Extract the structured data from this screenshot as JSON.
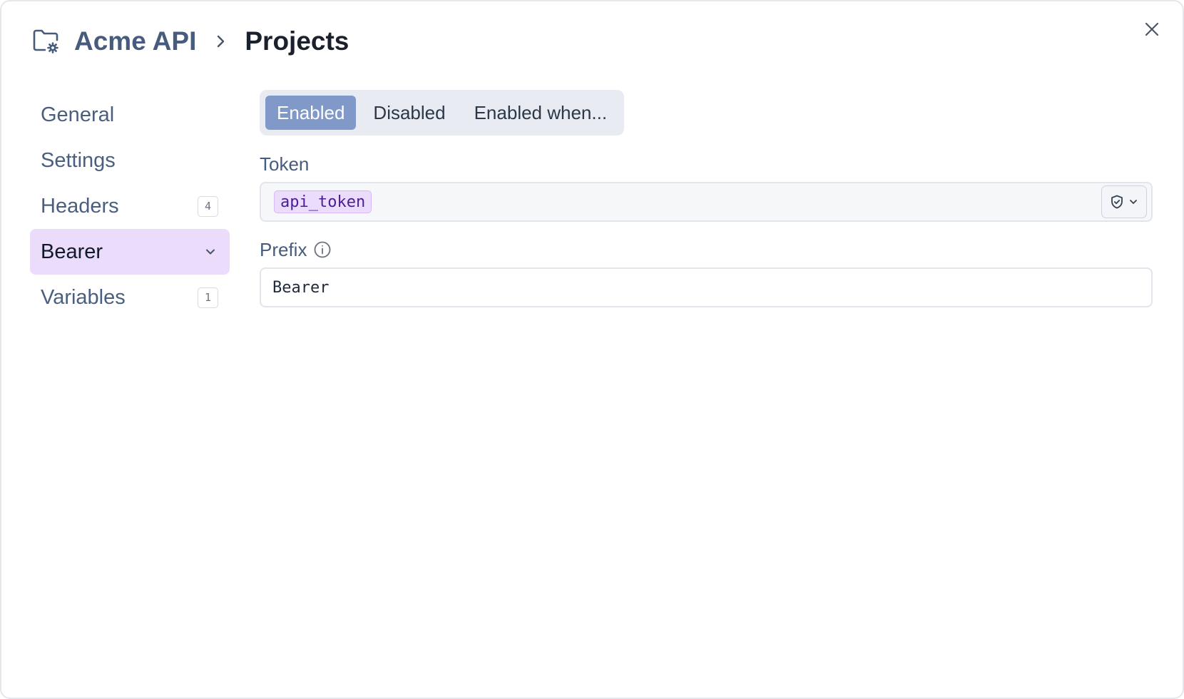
{
  "breadcrumb": {
    "parent": "Acme API",
    "current": "Projects"
  },
  "icons": {
    "folder": "folder-gear-icon",
    "separator": "chevron-right-icon",
    "close": "close-icon",
    "info": "info-icon",
    "shield": "shield-check-icon",
    "chevron_down": "chevron-down-icon"
  },
  "sidebar": {
    "items": [
      {
        "label": "General",
        "badge": ""
      },
      {
        "label": "Settings",
        "badge": ""
      },
      {
        "label": "Headers",
        "badge": "4"
      },
      {
        "label": "Bearer",
        "badge": "",
        "active": true
      },
      {
        "label": "Variables",
        "badge": "1"
      }
    ]
  },
  "auth_mode": {
    "options": [
      "Enabled",
      "Disabled",
      "Enabled when..."
    ],
    "selected": "Enabled"
  },
  "token": {
    "label": "Token",
    "value": "api_token"
  },
  "prefix": {
    "label": "Prefix",
    "value": "Bearer"
  },
  "colors": {
    "accent": "#8099c8",
    "active_nav_bg": "#ebdcfc",
    "token_chip_bg": "#ecdcfc",
    "token_chip_text": "#4c1d95"
  }
}
